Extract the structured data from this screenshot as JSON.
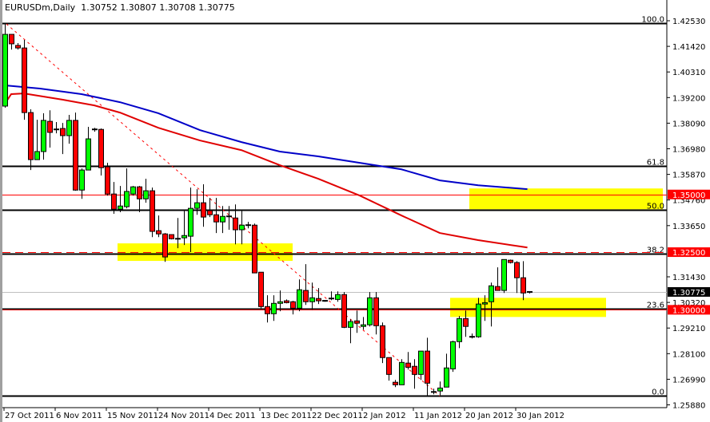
{
  "header": {
    "symbol": "EURUSDm,Daily",
    "open": "1.30752",
    "high": "1.30807",
    "low": "1.30708",
    "close": "1.30775"
  },
  "colors": {
    "bull": "#00ff00",
    "bear": "#ff0000",
    "ma_slow": "#0000c8",
    "ma_fast": "#e00000",
    "zone": "#ffff00",
    "level": "#ff0000"
  },
  "chart_data": {
    "type": "candlestick",
    "title": "EURUSDm,Daily",
    "ylim": [
      1.2558,
      1.4285
    ],
    "y_ticks": [
      "1.42530",
      "1.41420",
      "1.40310",
      "1.39200",
      "1.38090",
      "1.36980",
      "1.35870",
      "1.34760",
      "1.33650",
      "1.31430",
      "1.30320",
      "1.29210",
      "1.28100",
      "1.26990",
      "1.25880"
    ],
    "x_ticks": [
      {
        "bar": 0,
        "label": "27 Oct 2011"
      },
      {
        "bar": 8,
        "label": "6 Nov 2011"
      },
      {
        "bar": 16,
        "label": "15 Nov 2011"
      },
      {
        "bar": 24,
        "label": "24 Nov 2011"
      },
      {
        "bar": 32,
        "label": "4 Dec 2011"
      },
      {
        "bar": 40,
        "label": "13 Dec 2011"
      },
      {
        "bar": 48,
        "label": "22 Dec 2011"
      },
      {
        "bar": 56,
        "label": "2 Jan 2012"
      },
      {
        "bar": 64,
        "label": "11 Jan 2012"
      },
      {
        "bar": 72,
        "label": "20 Jan 2012"
      },
      {
        "bar": 80,
        "label": "30 Jan 2012"
      }
    ],
    "ohlc": [
      [
        1.3883,
        1.4239,
        1.3876,
        1.4194
      ],
      [
        1.4194,
        1.4194,
        1.4128,
        1.4153
      ],
      [
        1.4146,
        1.4156,
        1.4128,
        1.4135
      ],
      [
        1.4135,
        1.417,
        1.3824,
        1.3855
      ],
      [
        1.3855,
        1.3869,
        1.3606,
        1.3651
      ],
      [
        1.3651,
        1.3824,
        1.3651,
        1.3686
      ],
      [
        1.3686,
        1.3852,
        1.3651,
        1.3821
      ],
      [
        1.3817,
        1.3865,
        1.3703,
        1.3769
      ],
      [
        1.3782,
        1.3814,
        1.3765,
        1.3782
      ],
      [
        1.3786,
        1.381,
        1.3675,
        1.3755
      ],
      [
        1.3755,
        1.3845,
        1.372,
        1.3821
      ],
      [
        1.3821,
        1.3855,
        1.3516,
        1.3519
      ],
      [
        1.3519,
        1.3613,
        1.3481,
        1.3606
      ],
      [
        1.3606,
        1.3793,
        1.3606,
        1.3741
      ],
      [
        1.3782,
        1.3789,
        1.3772,
        1.3782
      ],
      [
        1.3782,
        1.3786,
        1.3582,
        1.3616
      ],
      [
        1.362,
        1.3637,
        1.3495,
        1.3502
      ],
      [
        1.3502,
        1.3554,
        1.3416,
        1.3436
      ],
      [
        1.3436,
        1.3537,
        1.3423,
        1.345
      ],
      [
        1.3447,
        1.3613,
        1.344,
        1.3513
      ],
      [
        1.3502,
        1.3537,
        1.3495,
        1.3533
      ],
      [
        1.3533,
        1.3537,
        1.3423,
        1.3481
      ],
      [
        1.3481,
        1.3568,
        1.3464,
        1.3516
      ],
      [
        1.3516,
        1.353,
        1.3315,
        1.334
      ],
      [
        1.3343,
        1.3409,
        1.3315,
        1.3329
      ],
      [
        1.3329,
        1.3333,
        1.3208,
        1.3229
      ],
      [
        1.3326,
        1.3326,
        1.3305,
        1.3308
      ],
      [
        1.3308,
        1.3398,
        1.3267,
        1.3308
      ],
      [
        1.3312,
        1.343,
        1.3281,
        1.3322
      ],
      [
        1.3319,
        1.353,
        1.325,
        1.344
      ],
      [
        1.344,
        1.3523,
        1.3412,
        1.3464
      ],
      [
        1.3464,
        1.3544,
        1.336,
        1.3402
      ],
      [
        1.343,
        1.3485,
        1.3402,
        1.3412
      ],
      [
        1.3412,
        1.3485,
        1.3333,
        1.3381
      ],
      [
        1.3381,
        1.345,
        1.3333,
        1.3405
      ],
      [
        1.3405,
        1.345,
        1.3347,
        1.3402
      ],
      [
        1.3398,
        1.3457,
        1.3284,
        1.3347
      ],
      [
        1.3347,
        1.343,
        1.3284,
        1.3367
      ],
      [
        1.3367,
        1.3381,
        1.3353,
        1.3367
      ],
      [
        1.3367,
        1.3374,
        1.316,
        1.316
      ],
      [
        1.3163,
        1.3163,
        1.3007,
        1.3014
      ],
      [
        1.3014,
        1.3063,
        1.2945,
        1.2983
      ],
      [
        1.2983,
        1.3063,
        1.2952,
        1.3028
      ],
      [
        1.3028,
        1.3084,
        1.2994,
        1.3035
      ],
      [
        1.3039,
        1.3045,
        1.3028,
        1.3031
      ],
      [
        1.3035,
        1.3039,
        1.298,
        1.3007
      ],
      [
        1.3007,
        1.3132,
        1.2994,
        1.3087
      ],
      [
        1.3084,
        1.3198,
        1.3021,
        1.3035
      ],
      [
        1.3035,
        1.3118,
        1.3,
        1.3052
      ],
      [
        1.3049,
        1.3094,
        1.3025,
        1.3039
      ],
      [
        1.3039,
        1.3042,
        1.3035,
        1.3039
      ],
      [
        1.3049,
        1.308,
        1.3042,
        1.3049
      ],
      [
        1.3045,
        1.308,
        1.3035,
        1.3066
      ],
      [
        1.3066,
        1.3077,
        1.2921,
        1.2924
      ],
      [
        1.2924,
        1.2959,
        1.2855,
        1.2949
      ],
      [
        1.2952,
        1.2997,
        1.29,
        1.2942
      ],
      [
        1.2928,
        1.2969,
        1.2914,
        1.2935
      ],
      [
        1.2935,
        1.3077,
        1.2928,
        1.3052
      ],
      [
        1.3052,
        1.3077,
        1.2893,
        1.2931
      ],
      [
        1.2931,
        1.2945,
        1.2769,
        1.2793
      ],
      [
        1.2793,
        1.2793,
        1.2693,
        1.272
      ],
      [
        1.2686,
        1.2696,
        1.2665,
        1.2675
      ],
      [
        1.2675,
        1.2786,
        1.2675,
        1.2772
      ],
      [
        1.2769,
        1.2817,
        1.2741,
        1.2751
      ],
      [
        1.2755,
        1.2786,
        1.2658,
        1.272
      ],
      [
        1.272,
        1.2821,
        1.2696,
        1.2821
      ],
      [
        1.2821,
        1.2879,
        1.2623,
        1.2682
      ],
      [
        1.2641,
        1.2658,
        1.2634,
        1.2644
      ],
      [
        1.2648,
        1.2689,
        1.263,
        1.2661
      ],
      [
        1.2665,
        1.281,
        1.2665,
        1.2748
      ],
      [
        1.2744,
        1.2866,
        1.2731,
        1.2862
      ],
      [
        1.2862,
        1.2973,
        1.2834,
        1.2962
      ],
      [
        1.2962,
        1.2997,
        1.2883,
        1.2928
      ],
      [
        1.2883,
        1.2897,
        1.2876,
        1.2883
      ],
      [
        1.2883,
        1.3052,
        1.2879,
        1.3025
      ],
      [
        1.3025,
        1.3063,
        1.2952,
        1.3031
      ],
      [
        1.3035,
        1.3118,
        1.2928,
        1.3104
      ],
      [
        1.3101,
        1.3184,
        1.3094,
        1.3084
      ],
      [
        1.3084,
        1.3218,
        1.3073,
        1.3218
      ],
      [
        1.3215,
        1.3218,
        1.3201,
        1.3205
      ],
      [
        1.3205,
        1.3211,
        1.3073,
        1.3139
      ],
      [
        1.3139,
        1.3211,
        1.3042,
        1.3073
      ],
      [
        1.30752,
        1.30807,
        1.30708,
        1.30775
      ]
    ],
    "ma_slow": [
      [
        0,
        1.3973
      ],
      [
        5.5,
        1.3959
      ],
      [
        12,
        1.3935
      ],
      [
        18,
        1.39
      ],
      [
        24,
        1.3852
      ],
      [
        30.5,
        1.3779
      ],
      [
        37,
        1.3727
      ],
      [
        43,
        1.3686
      ],
      [
        49,
        1.3665
      ],
      [
        55.5,
        1.3637
      ],
      [
        62,
        1.3609
      ],
      [
        68,
        1.3561
      ],
      [
        74,
        1.354
      ],
      [
        81.7,
        1.3523
      ]
    ],
    "ma_fast": [
      [
        0,
        1.3893
      ],
      [
        1,
        1.3935
      ],
      [
        3,
        1.3938
      ],
      [
        9,
        1.3911
      ],
      [
        14,
        1.3886
      ],
      [
        18,
        1.3855
      ],
      [
        24,
        1.3789
      ],
      [
        30.5,
        1.3734
      ],
      [
        37,
        1.3692
      ],
      [
        43,
        1.3627
      ],
      [
        49,
        1.3568
      ],
      [
        55.5,
        1.3495
      ],
      [
        62,
        1.3409
      ],
      [
        68,
        1.3333
      ],
      [
        74,
        1.3302
      ],
      [
        81.7,
        1.327
      ]
    ],
    "fibonacci": {
      "from": {
        "bar": 0,
        "price": 1.4239
      },
      "to": {
        "bar": 68,
        "price": 1.2627
      },
      "levels": [
        {
          "label": "100.0",
          "price": 1.4243
        },
        {
          "label": "61.8",
          "price": 1.3623
        },
        {
          "label": "50.0",
          "price": 1.3433
        },
        {
          "label": "38.2",
          "price": 1.3243
        },
        {
          "label": "23.6",
          "price": 1.3004
        },
        {
          "label": "0.0",
          "price": 1.2627
        }
      ]
    },
    "horizontal_levels": [
      {
        "label": "1.35000",
        "price": 1.35,
        "style": "solid"
      },
      {
        "label": "1.32500",
        "price": 1.325,
        "style": "dashed"
      },
      {
        "label": "1.30000",
        "price": 1.3,
        "style": "solid"
      }
    ],
    "current_price": {
      "label": "1.30775",
      "price": 1.30775
    },
    "zones": [
      {
        "bar_from": 73,
        "bar_to": 103,
        "price_top": 1.3526,
        "price_bottom": 1.3436
      },
      {
        "bar_from": 18,
        "bar_to": 45,
        "price_top": 1.3288,
        "price_bottom": 1.3212
      },
      {
        "bar_from": 70,
        "bar_to": 94,
        "price_top": 1.3052,
        "price_bottom": 1.2969
      }
    ]
  }
}
